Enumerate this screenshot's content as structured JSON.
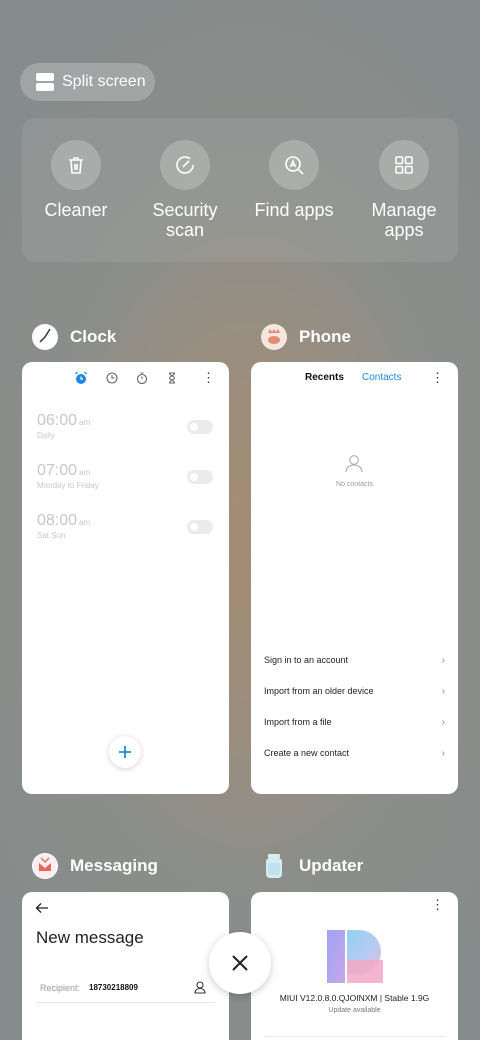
{
  "split_screen": {
    "label": "Split screen",
    "icon": "split-screen-icon"
  },
  "tools": [
    {
      "label_line1": "Cleaner",
      "label_line2": "",
      "icon": "trash-icon"
    },
    {
      "label_line1": "Security",
      "label_line2": "scan",
      "icon": "security-scan-icon"
    },
    {
      "label_line1": "Find apps",
      "label_line2": "",
      "icon": "find-apps-icon"
    },
    {
      "label_line1": "Manage",
      "label_line2": "apps",
      "icon": "grid-icon"
    }
  ],
  "clock": {
    "app_name": "Clock",
    "alarms": [
      {
        "time": "06:00",
        "ampm": "am",
        "repeat": "Daily"
      },
      {
        "time": "07:00",
        "ampm": "am",
        "repeat": "Monday to Friday"
      },
      {
        "time": "08:00",
        "ampm": "am",
        "repeat": "Sat Sun"
      }
    ],
    "accent_color": "#1e88e5"
  },
  "phone": {
    "app_name": "Phone",
    "tabs": [
      "Recents",
      "Contacts"
    ],
    "empty_text": "No contacts",
    "actions": [
      "Sign in to an account",
      "Import from an older device",
      "Import from a file",
      "Create a new contact"
    ]
  },
  "messaging": {
    "app_name": "Messaging",
    "title": "New message",
    "recipient_label": "Recipient:",
    "recipient_value": "18730218809"
  },
  "updater": {
    "app_name": "Updater",
    "version": "MIUI V12.0.8.0.QJOINXM | Stable 1.9G",
    "status": "Update available"
  }
}
